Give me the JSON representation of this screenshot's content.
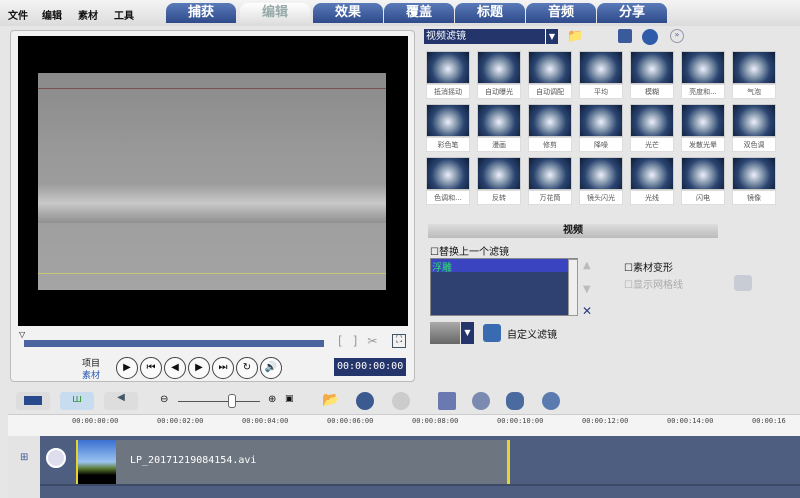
{
  "menu": [
    "文件",
    "编辑",
    "素材",
    "工具"
  ],
  "tabs": [
    "捕获",
    "编辑",
    "效果",
    "覆盖",
    "标题",
    "音频",
    "分享"
  ],
  "active_tab": "编辑",
  "player": {
    "project_label": "项目",
    "clip_label": "素材",
    "timecode": "00:00:00:00",
    "playhead_percent": 0
  },
  "filters": {
    "category": "视频滤镜",
    "items": [
      "抵消摇动",
      "自动曝光",
      "自动调配",
      "平均",
      "模糊",
      "亮度和...",
      "气泡",
      "彩色笔",
      "漫画",
      "修剪",
      "降噪",
      "光芒",
      "发散光晕",
      "双色调",
      "色调和...",
      "反转",
      "万花筒",
      "镜头闪光",
      "光线",
      "闪电",
      "镜像"
    ]
  },
  "options": {
    "section_title": "视频",
    "replace_last": "替换上一个滤镜",
    "applied": [
      "浮雕"
    ],
    "clip_warp": "素材变形",
    "show_grid": "显示网格线",
    "custom_filter": "自定义滤镜"
  },
  "timeline": {
    "ticks": [
      "00:00:00:00",
      "00:00:02:00",
      "00:00:04:00",
      "00:00:06:00",
      "00:00:08:00",
      "00:00:10:00",
      "00:00:12:00",
      "00:00:14:00",
      "00:00:16"
    ],
    "clip_name": "LP_20171219084154.avi"
  }
}
